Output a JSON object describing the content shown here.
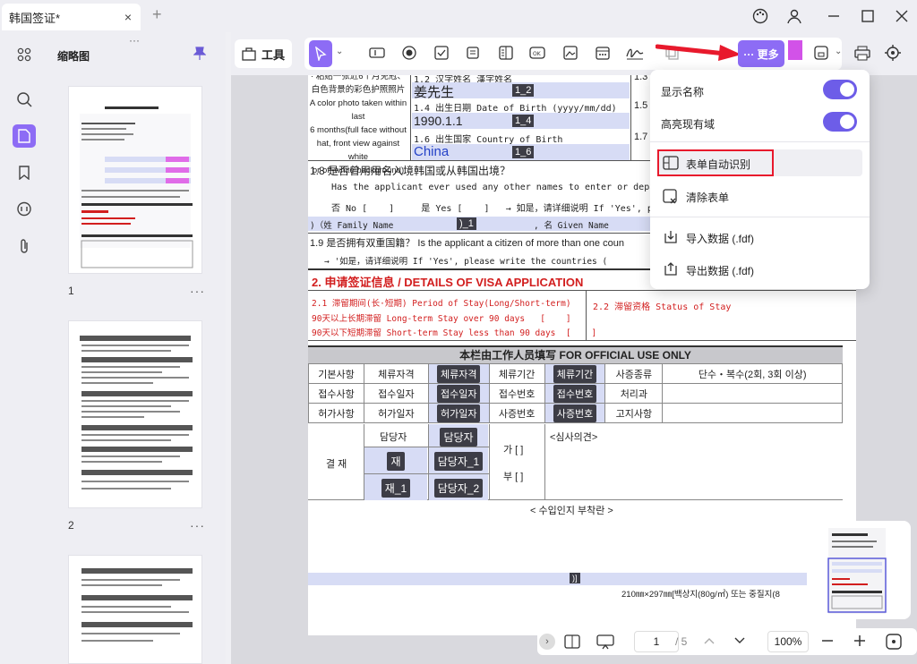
{
  "window": {
    "tab_title": "韩国签证*",
    "close_tab": "×",
    "new_tab": "+"
  },
  "thumbnails": {
    "title": "缩略图",
    "pages": [
      {
        "number": "1"
      },
      {
        "number": "2"
      }
    ],
    "more": "···"
  },
  "toolbar": {
    "tools_label": "工具",
    "more_label": "··· 更多"
  },
  "document": {
    "photo_note": [
      "· 粘贴一张近6个月免冠、",
      "白色背景的彩色护照照片",
      "A color photo taken within last",
      "6 months(full face without",
      "hat, front view against white",
      "or off-white background)"
    ],
    "f12_label": "1.2 汉字姓名 漢字姓名",
    "f12_value": "姜先生",
    "f12_tag": "1_2",
    "f13": "1.3",
    "f14_label": "1.4 出生日期 Date of Birth (yyyy/mm/dd)",
    "f14_value": "1990.1.1",
    "f14_tag": "1_4",
    "f15": "1.5",
    "f16_label": "1.6 出生国家 Country of Birth",
    "f16_value": "China",
    "f16_tag": "1_6",
    "f17": "1.7",
    "q18": "1.8  是否曾用用名入境韩国或从韩国出境？",
    "q18_en": "Has the applicant ever used any other names to enter or depart Kor",
    "q18_opts": "否 No [    ]     是 Yes [    ]   → 如是，请详细说明 If 'Yes', please",
    "q18_family": ")（姓 Family Name",
    "q18_tag": ")_1",
    "q18_given": ", 名 Given Name",
    "q19": "1.9 是否拥有双重国籍？ Is the applicant a citizen of more than one coun",
    "q19_note": "→ '如是，请详细说明 If 'Yes', please write the countries (",
    "s2_title": "2. 申请签证信息 / DETAILS OF VISA APPLICATION",
    "s21": "2.1 滞留期间(长·短期) Period of Stay(Long/Short-term)",
    "s21_a": "90天以上长期滞留 Long-term Stay over 90 days   [    ]",
    "s21_b": "90天以下短期滞留 Short-term Stay less than 90 days  [    ]",
    "s22": "2.2 滞留资格 Status of Stay",
    "office_title": "本栏由工作人员填写 FOR OFFICIAL USE ONLY",
    "table_rows": [
      [
        "기본사항",
        "체류자격",
        "체류자격",
        "체류기간",
        "체류기간",
        "사증종류",
        "단수・복수(2회, 3회 이상)"
      ],
      [
        "접수사항",
        "접수일자",
        "접수일자",
        "접수번호",
        "접수번호",
        "처리과",
        ""
      ],
      [
        "허가사항",
        "허가일자",
        "허가일자",
        "사증번호",
        "사증번호",
        "고지사항",
        ""
      ]
    ],
    "approval": "결 재",
    "officer": "담당자",
    "officer_tag": "담당자",
    "jae": "재",
    "jae1": "재_1",
    "officer1": "담당자_1",
    "officer2": "담당자_2",
    "ga": "가 [   ]",
    "bu": "부 [   ]",
    "review": "<심사의견>",
    "stamp": "< 수입인지 부착란 >",
    "footer_tag": ")]",
    "paper_size": "210㎜×297㎜[백상지(80g/㎡) 또는 중질지(8"
  },
  "menu": {
    "show_name": "显示名称",
    "highlight": "高亮现有域",
    "auto_detect": "表单自动识别",
    "clear_form": "清除表单",
    "import": "导入数据 (.fdf)",
    "export": "导出数据 (.fdf)",
    "show_name_on": true,
    "highlight_on": true
  },
  "bottombar": {
    "page": "1",
    "total": "/ 5",
    "zoom": "100%"
  },
  "colors": {
    "accent": "#8d6cf5",
    "annotation_red": "#e8192c"
  }
}
